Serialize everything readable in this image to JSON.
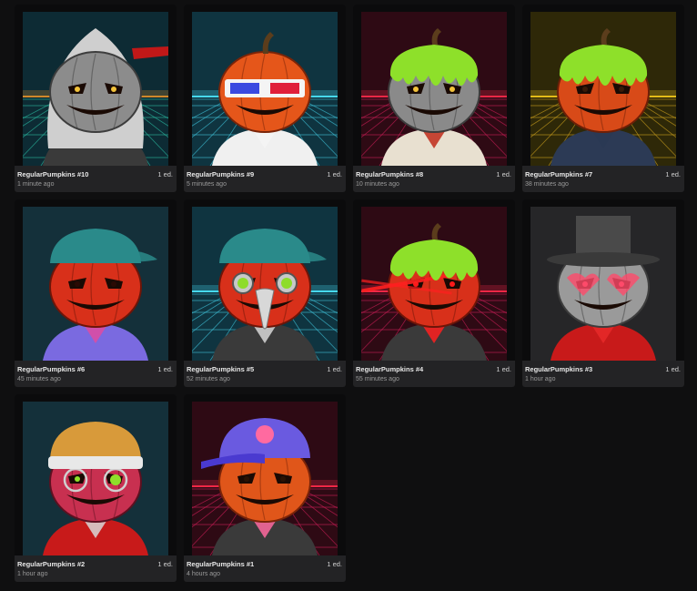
{
  "cards": [
    {
      "title": "RegularPumpkins #10",
      "edition": "1 ed.",
      "time": "1 minute ago",
      "art": {
        "bg": "#0d2b34",
        "horizon": "#e0902a",
        "grid": "#2fd0b0",
        "head": "#8c8c8c",
        "headStroke": "#3d3d3d",
        "eyes": "#f2c23a",
        "hat": "hood",
        "hatColor": "#cfcfcf",
        "accent": "#c01818",
        "body": "#3a3a3a",
        "slime": false,
        "glasses": "none"
      }
    },
    {
      "title": "RegularPumpkins #9",
      "edition": "1 ed.",
      "time": "5 minutes ago",
      "art": {
        "bg": "#0f3440",
        "horizon": "#4de6ff",
        "grid": "#47d8f0",
        "head": "#e5561a",
        "headStroke": "#7a2408",
        "eyes": "#ffffff",
        "hat": "stem",
        "hatColor": "#5b3d1c",
        "accent": "#f5f5f5",
        "body": "#f0f0f0",
        "slime": false,
        "glasses": "3d"
      }
    },
    {
      "title": "RegularPumpkins #8",
      "edition": "1 ed.",
      "time": "10 minutes ago",
      "art": {
        "bg": "#2e0a14",
        "horizon": "#ff2a4a",
        "grid": "#e02060",
        "head": "#8a8a8a",
        "headStroke": "#3d3d3d",
        "eyes": "#f2c23a",
        "hat": "slime",
        "hatColor": "#8ee02a",
        "accent": "#c02a1a",
        "body": "#e8e0d0",
        "slime": true,
        "glasses": "none"
      }
    },
    {
      "title": "RegularPumpkins #7",
      "edition": "1 ed.",
      "time": "38 minutes ago",
      "art": {
        "bg": "#2e2808",
        "horizon": "#f2c81a",
        "grid": "#e0b020",
        "head": "#d84a18",
        "headStroke": "#6d1f07",
        "eyes": "#3a1a08",
        "hat": "slime",
        "hatColor": "#8ee02a",
        "accent": "#2a3a55",
        "body": "#2c3a55",
        "slime": true,
        "glasses": "none"
      }
    },
    {
      "title": "RegularPumpkins #6",
      "edition": "1 ed.",
      "time": "45 minutes ago",
      "art": {
        "bg": "#14303a",
        "horizon": "#14303a",
        "grid": "#14303a",
        "head": "#d8301a",
        "headStroke": "#6d1508",
        "eyes": "#2a0a04",
        "hat": "cap",
        "hatColor": "#2a8a8a",
        "accent": "#e04aa0",
        "body": "#7a6ae0",
        "slime": false,
        "glasses": "none"
      }
    },
    {
      "title": "RegularPumpkins #5",
      "edition": "1 ed.",
      "time": "52 minutes ago",
      "art": {
        "bg": "#0f3440",
        "horizon": "#4de6ff",
        "grid": "#47d8f0",
        "head": "#d8301a",
        "headStroke": "#6d1508",
        "eyes": "#8edc2a",
        "hat": "cap",
        "hatColor": "#2a8a8a",
        "accent": "#d8d8d8",
        "body": "#3a3a3a",
        "slime": false,
        "glasses": "plague"
      }
    },
    {
      "title": "RegularPumpkins #4",
      "edition": "1 ed.",
      "time": "55 minutes ago",
      "art": {
        "bg": "#2e0a14",
        "horizon": "#ff2a4a",
        "grid": "#e02060",
        "head": "#d8301a",
        "headStroke": "#6d1508",
        "eyes": "#ff1a1a",
        "hat": "slime",
        "hatColor": "#8ee02a",
        "accent": "#ff2020",
        "body": "#3a3a3a",
        "slime": true,
        "glasses": "laser"
      }
    },
    {
      "title": "RegularPumpkins #3",
      "edition": "1 ed.",
      "time": "1 hour ago",
      "art": {
        "bg": "#262628",
        "horizon": "#262628",
        "grid": "#262628",
        "head": "#9a9a9a",
        "headStroke": "#3d3d3d",
        "eyes": "#ff4a6a",
        "hat": "tophat",
        "hatColor": "#4a4a4a",
        "accent": "#e82a2a",
        "body": "#c81a1a",
        "slime": false,
        "glasses": "heart"
      }
    },
    {
      "title": "RegularPumpkins #2",
      "edition": "1 ed.",
      "time": "1 hour ago",
      "art": {
        "bg": "#14303a",
        "horizon": "#14303a",
        "grid": "#14303a",
        "head": "#c83050",
        "headStroke": "#5d1020",
        "eyes": "#8ee02a",
        "hat": "beanie",
        "hatColor": "#d89a3a",
        "accent": "#d8d8d8",
        "body": "#c81a1a",
        "slime": false,
        "glasses": "round"
      }
    },
    {
      "title": "RegularPumpkins #1",
      "edition": "1 ed.",
      "time": "4 hours ago",
      "art": {
        "bg": "#2e0a14",
        "horizon": "#ff2a4a",
        "grid": "#e02060",
        "head": "#e0561a",
        "headStroke": "#7a2408",
        "eyes": "#2a1204",
        "hat": "truckercap",
        "hatColor": "#6a5ae0",
        "accent": "#ff6aa0",
        "body": "#3a3a3a",
        "slime": false,
        "glasses": "none"
      }
    }
  ]
}
